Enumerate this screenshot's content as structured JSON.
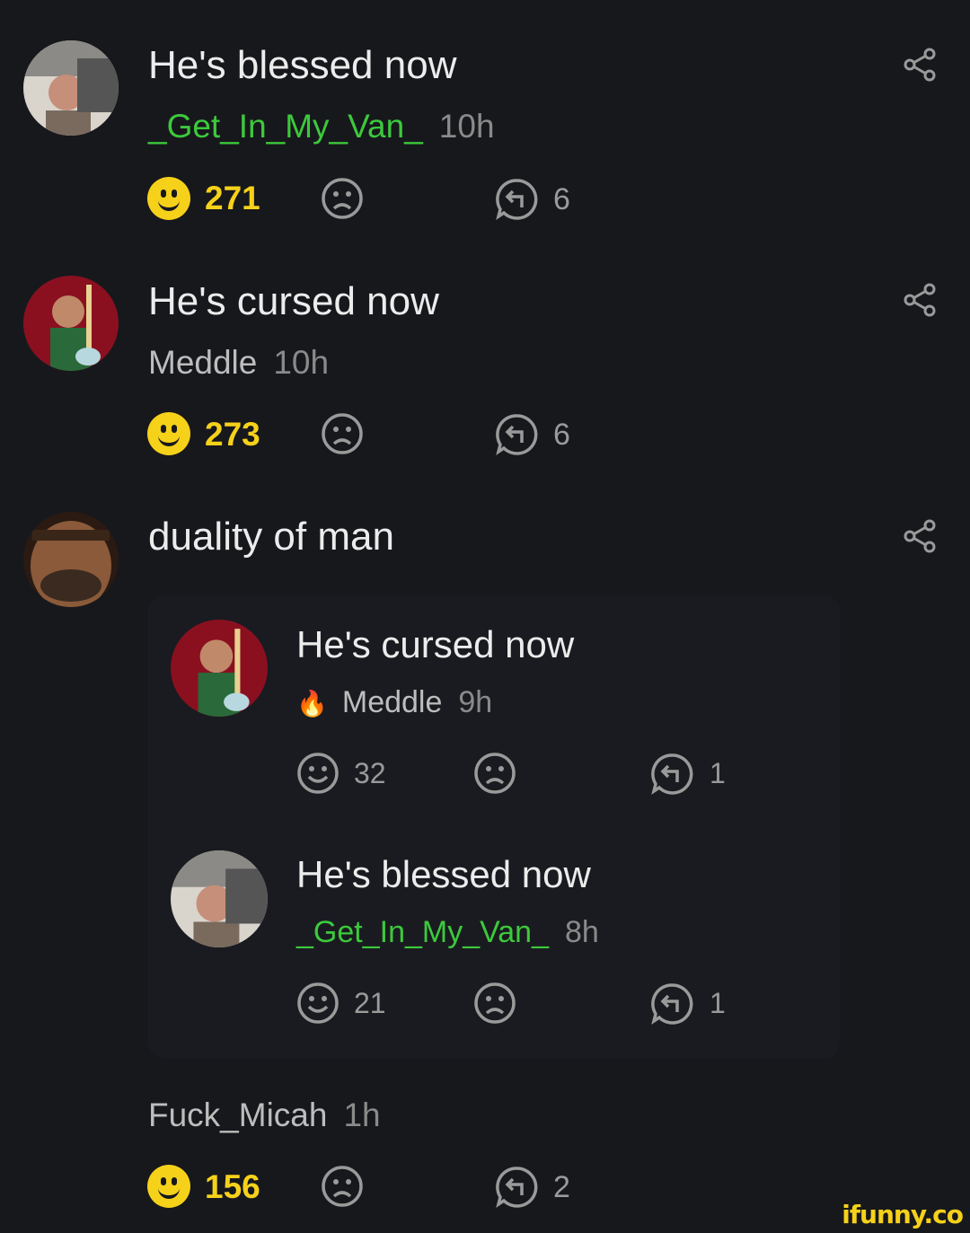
{
  "comments": [
    {
      "text": "He's blessed now",
      "user": "_Get_In_My_Van_",
      "time": "10h",
      "smiles": "271",
      "replies": "6"
    },
    {
      "text": "He's cursed now",
      "user": "Meddle",
      "time": "10h",
      "smiles": "273",
      "replies": "6"
    },
    {
      "text": "duality of man"
    }
  ],
  "quoted": [
    {
      "text": "He's cursed now",
      "user": "Meddle",
      "time": "9h",
      "smiles": "32",
      "replies": "1"
    },
    {
      "text": "He's blessed now",
      "user": "_Get_In_My_Van_",
      "time": "8h",
      "smiles": "21",
      "replies": "1"
    }
  ],
  "footer": {
    "user": "Fuck_Micah",
    "time": "1h",
    "smiles": "156",
    "replies": "2"
  },
  "watermark": "ifunny.co",
  "colors": {
    "accent": "#f6d11a",
    "green_user": "#3cc93c",
    "background": "#17181c"
  }
}
